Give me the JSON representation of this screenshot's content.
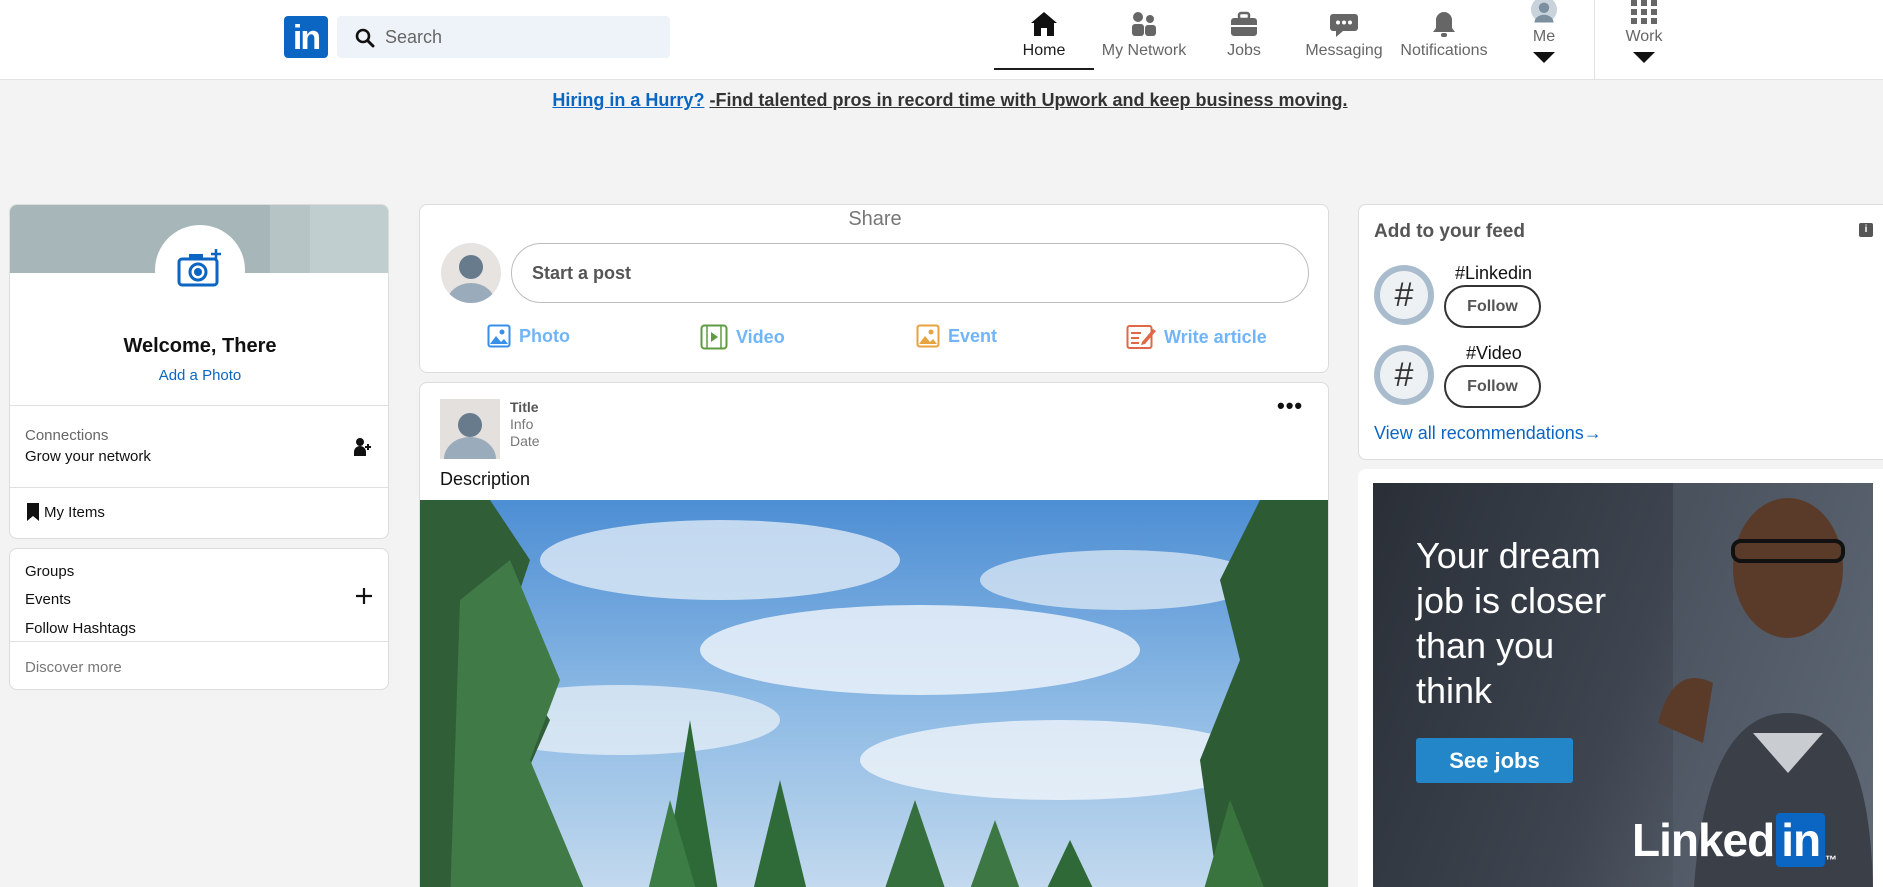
{
  "nav": {
    "logo": "in",
    "search_placeholder": "Search",
    "items": [
      {
        "label": "Home",
        "icon": "home-icon"
      },
      {
        "label": "My Network",
        "icon": "network-icon"
      },
      {
        "label": "Jobs",
        "icon": "briefcase-icon"
      },
      {
        "label": "Messaging",
        "icon": "chat-icon"
      },
      {
        "label": "Notifications",
        "icon": "bell-icon"
      },
      {
        "label": "Me",
        "icon": "avatar-icon"
      },
      {
        "label": "Work",
        "icon": "grid-icon"
      }
    ]
  },
  "banner": {
    "link": "Hiring in a Hurry?",
    "text": "-Find talented pros in record time with Upwork and keep business moving."
  },
  "profile": {
    "welcome": "Welcome, There",
    "add_photo": "Add a Photo",
    "connections_label": "Connections",
    "connections_sub": "Grow your network",
    "my_items": "My Items"
  },
  "groups": {
    "items": [
      "Groups",
      "Events",
      "Follow Hashtags"
    ],
    "discover": "Discover more"
  },
  "share": {
    "title": "Share",
    "start_post": "Start a post",
    "actions": [
      "Photo",
      "Video",
      "Event",
      "Write article"
    ]
  },
  "post": {
    "title": "Title",
    "info": "Info",
    "date": "Date",
    "more": "•••",
    "description": "Description"
  },
  "feed": {
    "title": "Add to your feed",
    "info_icon": "i",
    "recommendations": [
      {
        "tag": "#Linkedin",
        "button": "Follow"
      },
      {
        "tag": "#Video",
        "button": "Follow"
      }
    ],
    "view_all": "View all recommendations",
    "view_all_arrow": "→"
  },
  "ad": {
    "lines": [
      "Your dream",
      "job is closer",
      "than you",
      "think"
    ],
    "cta": "See jobs",
    "brand": "Linked",
    "brand_in": "in",
    "brand_tm": "™"
  },
  "colors": {
    "brand": "#0a66c2",
    "action_blue": "#70b5f9",
    "video_green": "#5f9b41",
    "event_orange": "#e7a33e",
    "article_red": "#e06847"
  }
}
